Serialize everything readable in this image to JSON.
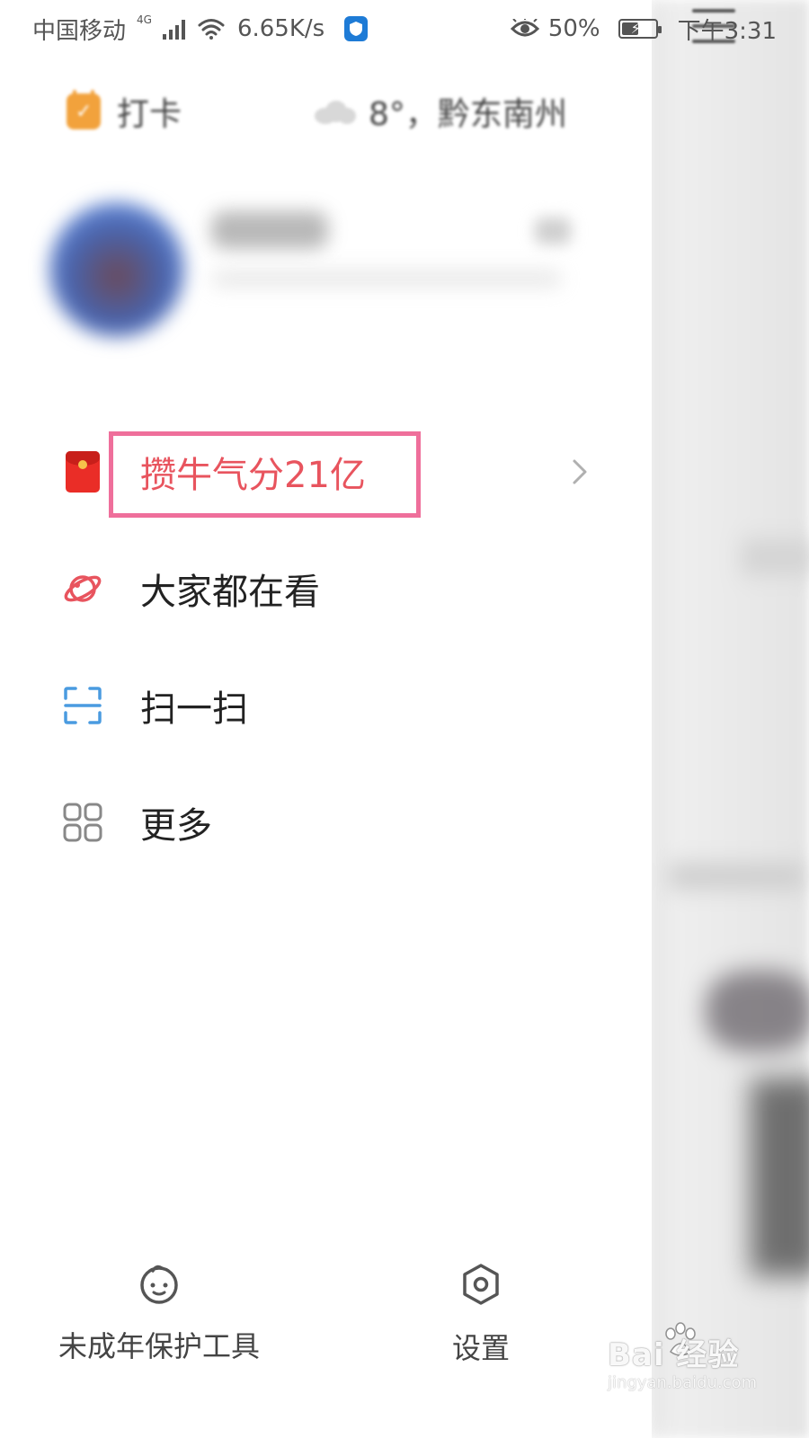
{
  "status_bar": {
    "carrier": "中国移动",
    "network_type": "4G",
    "speed": "6.65K/s",
    "battery_percent": "50%",
    "battery_level": 0.5,
    "time": "下午3:31",
    "icons": [
      "signal-icon",
      "wifi-icon",
      "shield-icon",
      "eye-icon",
      "battery-icon"
    ]
  },
  "header": {
    "checkin_label": "打卡",
    "weather_text": "8°，黔东南州",
    "menu_icon": "hamburger-menu-icon"
  },
  "menu": {
    "items": [
      {
        "label": "攒牛气分21亿",
        "icon": "red-packet-icon",
        "highlighted": true,
        "has_chevron": true
      },
      {
        "label": "大家都在看",
        "icon": "planet-icon"
      },
      {
        "label": "扫一扫",
        "icon": "scan-icon"
      },
      {
        "label": "更多",
        "icon": "grid-icon"
      }
    ]
  },
  "bottom_tools": {
    "minor_protection_label": "未成年保护工具",
    "settings_label": "设置"
  },
  "watermark": {
    "brand": "Bai  经验",
    "url": "jingyan.baidu.com"
  },
  "colors": {
    "highlight_text": "#e8545e",
    "highlight_border": "#ef6f9b",
    "checkin_orange": "#f2a23c",
    "scan_blue": "#4a9be0",
    "planet_red": "#e8545e",
    "shield_blue": "#1e7bd6"
  }
}
